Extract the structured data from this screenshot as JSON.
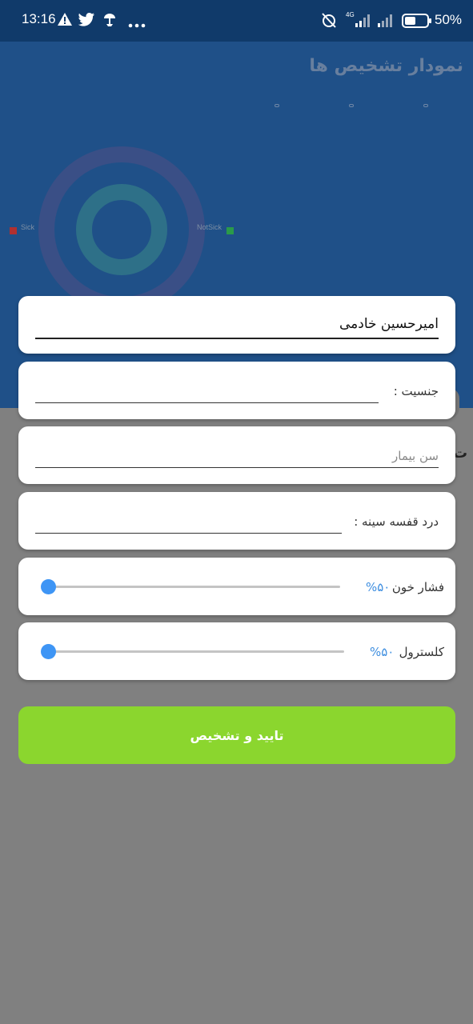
{
  "status_bar": {
    "time": "13:16",
    "network_label": "4G",
    "battery_text": "50%",
    "battery_level": 0.5
  },
  "background": {
    "chart_title": "نمودار تشخیص ها",
    "legend": {
      "sick_label": "Sick",
      "notsick_label": "NotSick",
      "sick_color": "#b03030",
      "notsick_color": "#2a9a4a"
    },
    "peek_text": "ت"
  },
  "form": {
    "name_value": "امیرحسین خادمی",
    "gender_label": "جنسیت :",
    "age_placeholder": "سن بیمار",
    "chest_pain_label": "درد قفسه سینه :",
    "blood_pressure": {
      "label": "فشار خون",
      "percent_text": "%۵۰",
      "value": 0
    },
    "cholesterol": {
      "label": "کلسترول",
      "percent_text": "%۵۰",
      "value": 0
    },
    "submit_label": "تایید و تشخیص"
  },
  "colors": {
    "accent_blue": "#3e95f5",
    "submit_green": "#8bd62e",
    "header_blue": "#103a6a"
  }
}
